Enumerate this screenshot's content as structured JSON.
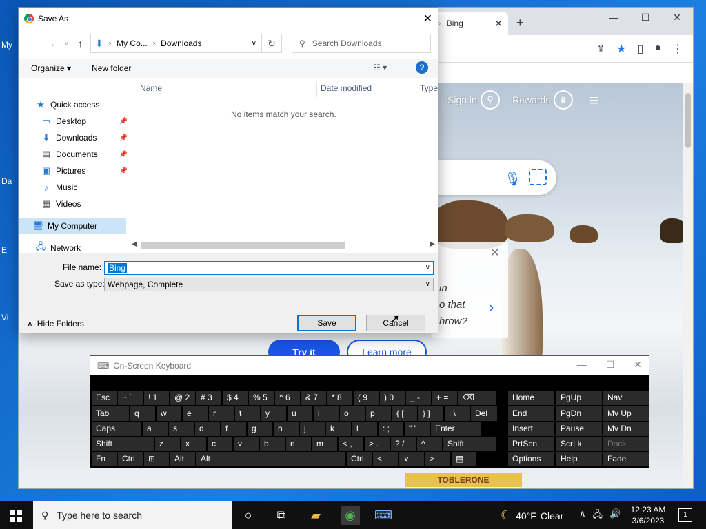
{
  "desktop": {
    "fragments": [
      "My",
      "Da",
      "E",
      "Vi"
    ]
  },
  "chrome": {
    "tab_title": "Bing",
    "tab_close": "✕",
    "new_tab": "+",
    "win_min": "—",
    "win_max": "☐",
    "win_close": "✕",
    "toolbar_icons": [
      "⇪",
      "★",
      "▯",
      "●",
      "⋮"
    ]
  },
  "bing": {
    "sign_in": "Sign in",
    "rewards": "Rewards",
    "quiz_lines": [
      "in",
      "o that",
      "hrow?"
    ],
    "try_it": "Try it",
    "learn_more": "Learn more",
    "ad_text": "TOBLERONE"
  },
  "dialog": {
    "title": "Save As",
    "close": "✕",
    "breadcrumb": [
      "My Co...",
      "Downloads"
    ],
    "search_placeholder": "Search Downloads",
    "organize": "Organize ▾",
    "new_folder": "New folder",
    "help": "?",
    "nav": {
      "quick_access": "Quick access",
      "items": [
        {
          "label": "Desktop",
          "icon": "desktop-folder-icon",
          "pinned": true
        },
        {
          "label": "Downloads",
          "icon": "downloads-icon",
          "pinned": true
        },
        {
          "label": "Documents",
          "icon": "documents-icon",
          "pinned": true
        },
        {
          "label": "Pictures",
          "icon": "pictures-icon",
          "pinned": true
        },
        {
          "label": "Music",
          "icon": "music-icon",
          "pinned": false
        },
        {
          "label": "Videos",
          "icon": "videos-icon",
          "pinned": false
        }
      ],
      "my_computer": "My Computer",
      "network": "Network"
    },
    "columns": [
      "Name",
      "Date modified",
      "Type"
    ],
    "empty_message": "No items match your search.",
    "file_name_label": "File name:",
    "file_name_value": "Bing",
    "save_type_label": "Save as type:",
    "save_type_value": "Webpage, Complete",
    "hide_folders": "Hide Folders",
    "save_button": "Save",
    "cancel_button": "Cancel"
  },
  "osk": {
    "title": "On-Screen Keyboard",
    "rows": [
      [
        "Esc",
        "~ `",
        "! 1",
        "@ 2",
        "# 3",
        "$ 4",
        "% 5",
        "^ 6",
        "& 7",
        "* 8",
        "( 9",
        ") 0",
        "_ -",
        "+ =",
        "⌫"
      ],
      [
        "Tab",
        "q",
        "w",
        "e",
        "r",
        "t",
        "y",
        "u",
        "i",
        "o",
        "p",
        "{ [",
        "} ]",
        "| \\",
        "Del"
      ],
      [
        "Caps",
        "a",
        "s",
        "d",
        "f",
        "g",
        "h",
        "j",
        "k",
        "l",
        ": ;",
        "\" '",
        "Enter"
      ],
      [
        "Shift",
        "z",
        "x",
        "c",
        "v",
        "b",
        "n",
        "m",
        "< ,",
        "> .",
        "? /",
        "^",
        "Shift"
      ],
      [
        "Fn",
        "Ctrl",
        "⊞",
        "Alt",
        "Alt",
        "Ctrl",
        "<",
        "∨",
        ">",
        "▤"
      ]
    ],
    "nav_keys": [
      [
        "Home",
        "PgUp",
        "Nav"
      ],
      [
        "End",
        "PgDn",
        "Mv Up"
      ],
      [
        "Insert",
        "Pause",
        "Mv Dn"
      ],
      [
        "PrtScn",
        "ScrLk",
        "Dock"
      ],
      [
        "Options",
        "Help",
        "Fade"
      ]
    ]
  },
  "taskbar": {
    "search_placeholder": "Type here to search",
    "temperature": "40°F",
    "weather": "Clear",
    "time": "12:23 AM",
    "date": "3/6/2023",
    "notifications": "1"
  }
}
